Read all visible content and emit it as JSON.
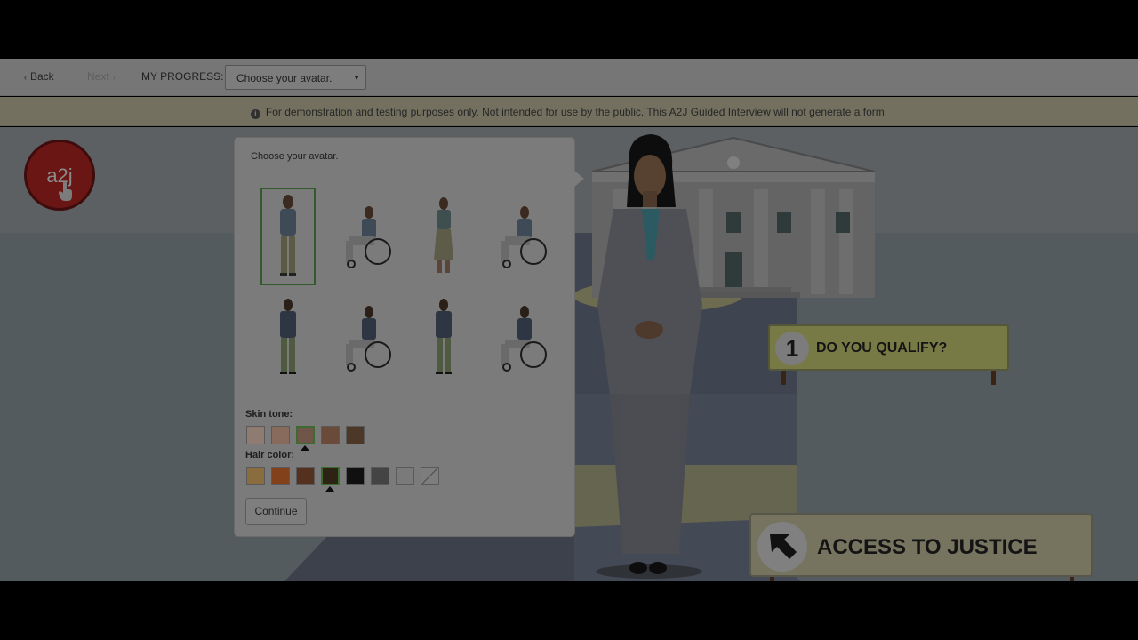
{
  "nav": {
    "back_label": "Back",
    "next_label": "Next",
    "progress_label": "MY PROGRESS:",
    "progress_value": "Choose your avatar."
  },
  "banner": {
    "text": "For demonstration and testing purposes only. Not intended for use by the public. This A2J Guided Interview will not generate a form."
  },
  "logo": {
    "text": "a2j"
  },
  "panel": {
    "title": "Choose your avatar.",
    "skin_label": "Skin tone:",
    "hair_label": "Hair color:",
    "continue_label": "Continue",
    "skin_tones": [
      "#8e7c72",
      "#896b5e",
      "#6f5648",
      "#6a4a38",
      "#4d3726"
    ],
    "hair_colors": [
      "#8a6d3e",
      "#82401b",
      "#54311f",
      "#2e2214",
      "#101010",
      "#444444",
      "#7a7a7a",
      "#7d7d7d"
    ]
  },
  "signs": {
    "step_number": "1",
    "step_text": "DO YOU QUALIFY?",
    "brand_text": "ACCESS TO JUSTICE"
  }
}
